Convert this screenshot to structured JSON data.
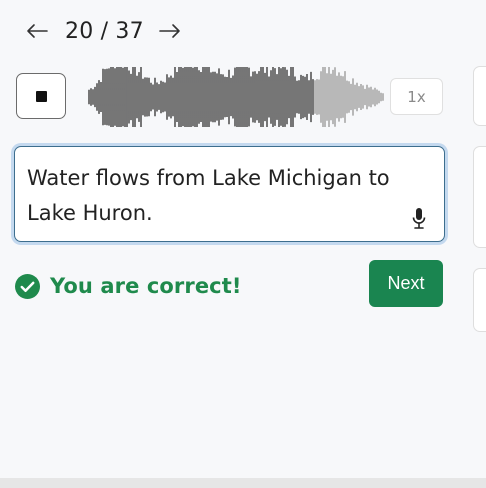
{
  "navigation": {
    "prev_icon": "arrow-left-icon",
    "next_icon": "arrow-right-icon",
    "current": "20",
    "total": "37",
    "counter_text": "20 / 37"
  },
  "player": {
    "stop_icon": "stop-icon",
    "playback_speed": "1x",
    "progress": 0.76
  },
  "answer": {
    "text": "Water flows from Lake Michigan to Lake Huron.",
    "mic_icon": "microphone-icon"
  },
  "result": {
    "icon": "check-circle-icon",
    "message": "You are correct!",
    "color": "#1f8a4c"
  },
  "actions": {
    "next_label": "Next",
    "next_color": "#1a8550"
  },
  "colors": {
    "background": "#f7f8fa",
    "focus_ring": "#c4d9ef",
    "wave_played": "#555555",
    "wave_unplayed": "#a8a8a8"
  }
}
